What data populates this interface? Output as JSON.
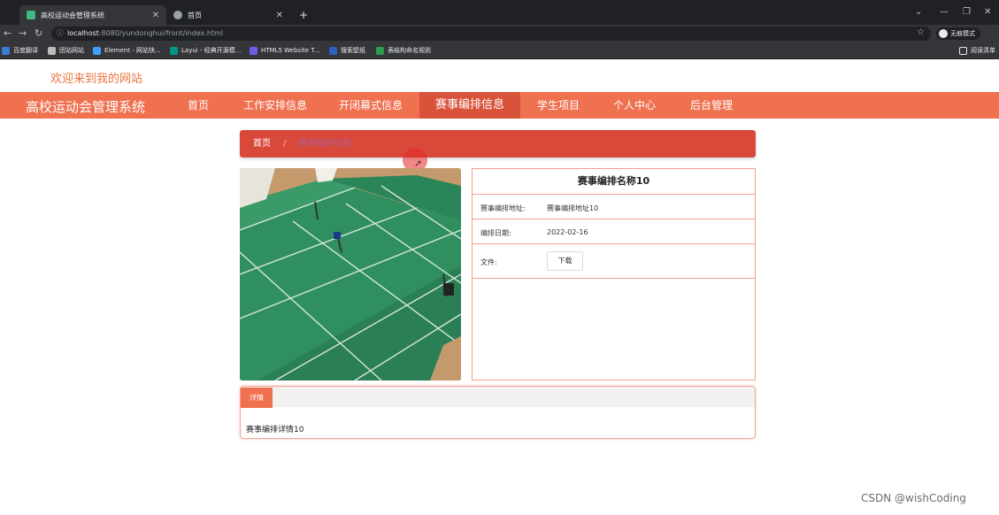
{
  "browser": {
    "tabs": [
      {
        "title": "高校运动会管理系统",
        "active": true
      },
      {
        "title": "首页",
        "active": false
      }
    ],
    "new_tab": "+",
    "url_host": "localhost",
    "url_rest": ":8080/yundonghui/front/index.html",
    "profile_label": "无痕模式",
    "bookmarks": [
      {
        "label": "百度翻译",
        "color": "#3a7bd5"
      },
      {
        "label": "团站网站",
        "color": "#222222"
      },
      {
        "label": "Element - 网站快...",
        "color": "#409eff"
      },
      {
        "label": "Layui - 经典开源模...",
        "color": "#009688"
      },
      {
        "label": "HTML5 Website T...",
        "color": "#6c5ce7"
      },
      {
        "label": "搜索壁纸",
        "color": "#3060c0"
      },
      {
        "label": "表结构命名规则",
        "color": "#2e9b4e"
      }
    ],
    "reading_list": "阅读清单"
  },
  "page": {
    "welcome": "欢迎来到我的网站",
    "brand": "高校运动会管理系统",
    "nav": [
      {
        "label": "首页",
        "active": false
      },
      {
        "label": "工作安排信息",
        "active": false
      },
      {
        "label": "开闭幕式信息",
        "active": false
      },
      {
        "label": "赛事编排信息",
        "active": true
      },
      {
        "label": "学生项目",
        "active": false
      },
      {
        "label": "个人中心",
        "active": false
      },
      {
        "label": "后台管理",
        "active": false
      }
    ],
    "breadcrumb": {
      "home": "首页",
      "separator": "/",
      "current": "赛事编排信息"
    },
    "detail": {
      "title": "赛事编排名称10",
      "address_label": "赛事编排地址:",
      "address_value": "赛事编排地址10",
      "date_label": "编排日期:",
      "date_value": "2022-02-16",
      "file_label": "文件:",
      "download_label": "下载"
    },
    "details_tab": "详情",
    "details_content": "赛事编排详情10"
  },
  "watermark": "CSDN @wishCoding",
  "colors": {
    "accent": "#ef7150",
    "accent_dark": "#d8493a",
    "welcome": "#e9733f"
  }
}
